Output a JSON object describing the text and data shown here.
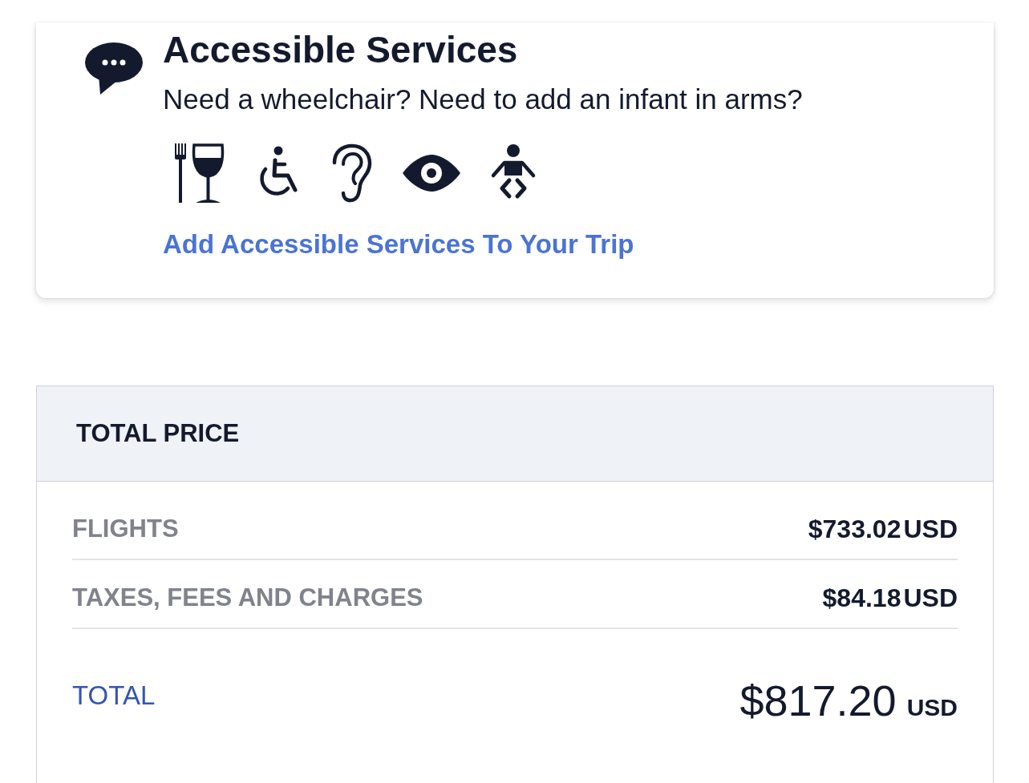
{
  "accessible_services": {
    "title": "Accessible Services",
    "description": "Need a wheelchair? Need to add an infant in arms?",
    "link": "Add Accessible Services To Your Trip"
  },
  "total_price": {
    "title": "TOTAL PRICE",
    "rows": [
      {
        "label": "FLIGHTS",
        "amount": "$733.02",
        "currency": "USD"
      },
      {
        "label": "TAXES, FEES AND CHARGES",
        "amount": "$84.18",
        "currency": "USD"
      }
    ],
    "total": {
      "label": "TOTAL",
      "amount": "$817.20",
      "currency": "USD"
    }
  }
}
